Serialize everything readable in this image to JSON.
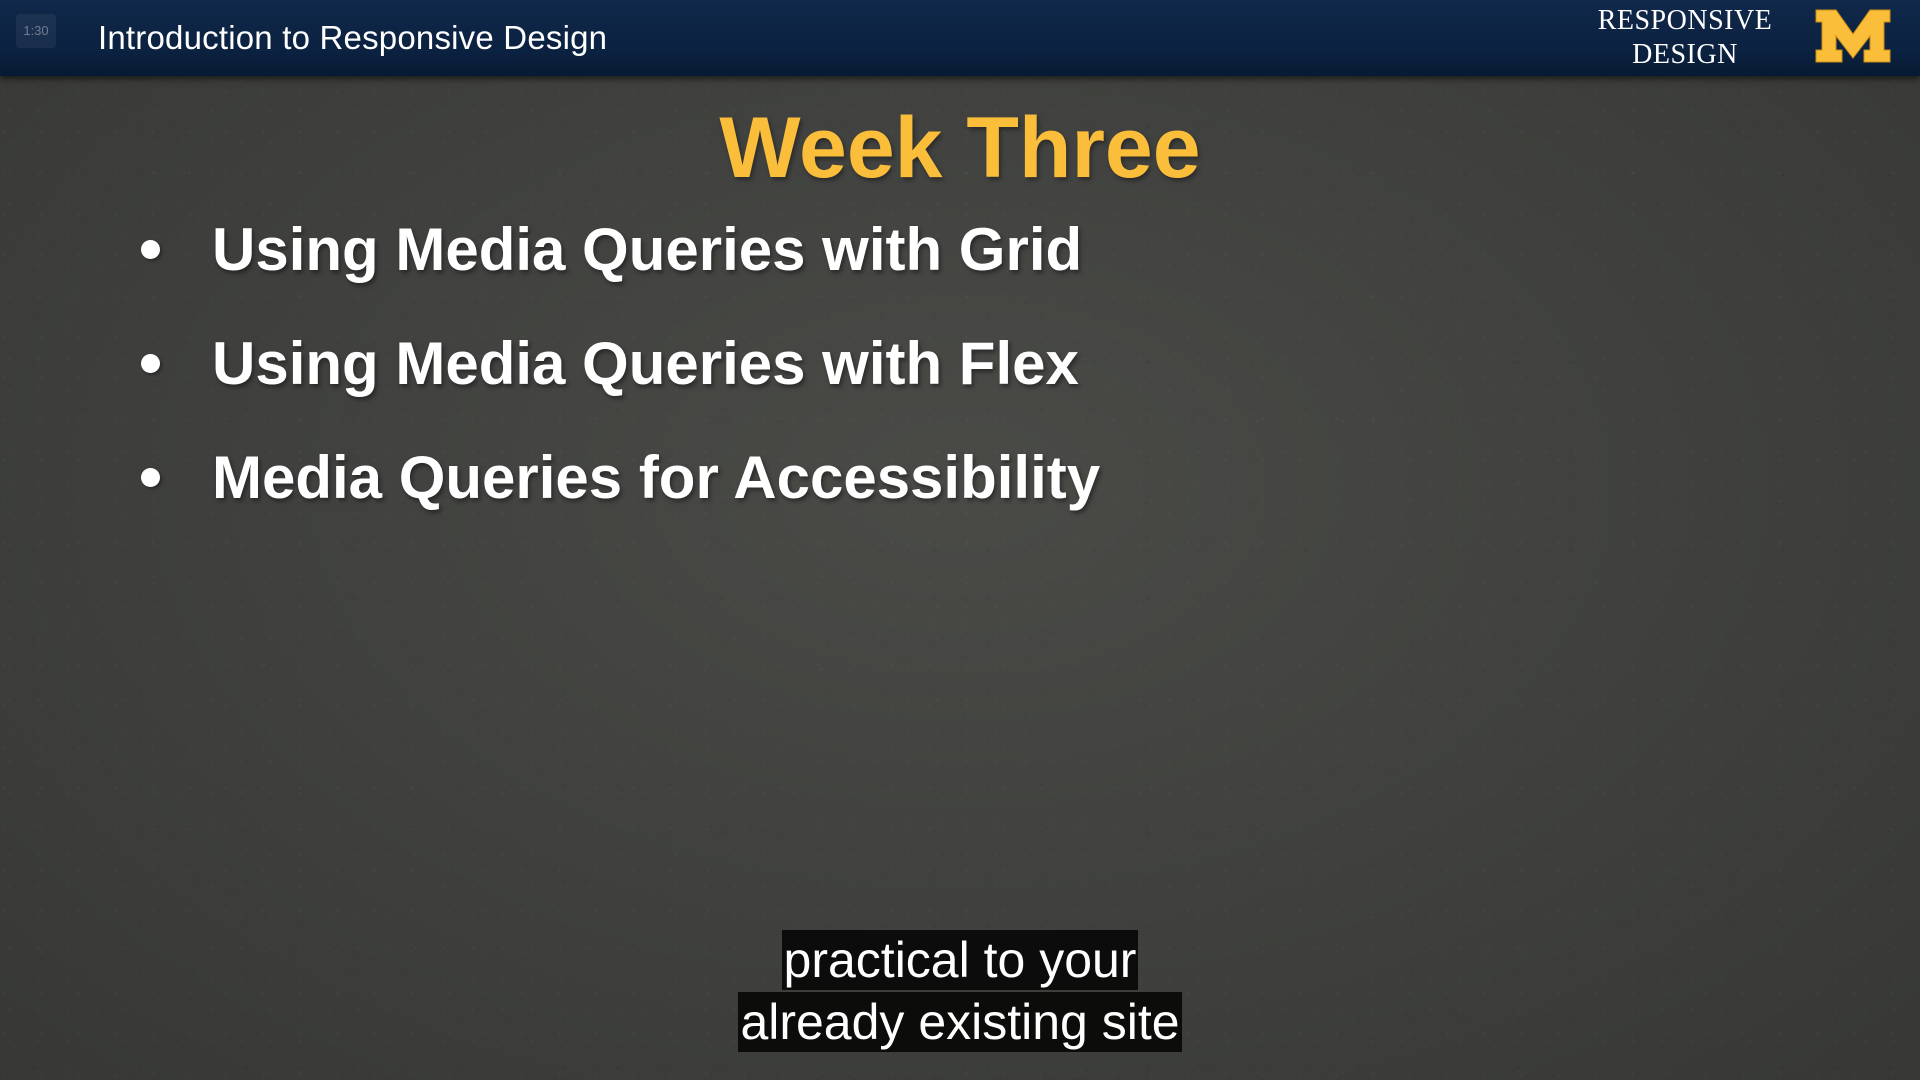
{
  "header": {
    "timestamp": "1:30",
    "course_title": "Introduction to Responsive Design",
    "brand_line1": "RESPONSIVE",
    "brand_line2": "DESIGN",
    "logo_letter": "M",
    "logo_color": "#fbbe3b",
    "background_color": "#0b2140"
  },
  "slide": {
    "title": "Week Three",
    "title_color": "#fbbe3b",
    "bullets": [
      {
        "label": "Using Media Queries with Grid"
      },
      {
        "label": "Using Media Queries with Flex"
      },
      {
        "label": "Media Queries for Accessibility"
      }
    ]
  },
  "captions": {
    "lines": [
      "practical to your",
      "already existing site"
    ]
  }
}
